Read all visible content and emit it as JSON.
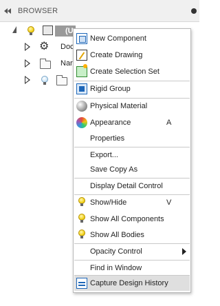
{
  "panel": {
    "title": "BROWSER"
  },
  "tree": {
    "root_label": "(U",
    "children": [
      {
        "label": "Doc"
      },
      {
        "label": "Nar"
      }
    ]
  },
  "context_menu": {
    "items": [
      {
        "id": "new-component",
        "label": "New Component",
        "icon": "new-component-icon"
      },
      {
        "id": "create-drawing",
        "label": "Create Drawing",
        "icon": "create-drawing-icon"
      },
      {
        "id": "create-selection-set",
        "label": "Create Selection Set",
        "icon": "selection-set-icon"
      },
      {
        "id": "rigid-group",
        "label": "Rigid Group",
        "icon": "rigid-group-icon"
      },
      {
        "id": "physical-material",
        "label": "Physical Material",
        "icon": "physical-material-icon"
      },
      {
        "id": "appearance",
        "label": "Appearance",
        "shortcut": "A",
        "icon": "appearance-icon"
      },
      {
        "id": "properties",
        "label": "Properties"
      },
      {
        "id": "export",
        "label": "Export..."
      },
      {
        "id": "save-copy-as",
        "label": "Save Copy As"
      },
      {
        "id": "display-detail-control",
        "label": "Display Detail Control"
      },
      {
        "id": "show-hide",
        "label": "Show/Hide",
        "shortcut": "V",
        "icon": "lightbulb-icon"
      },
      {
        "id": "show-all-components",
        "label": "Show All Components",
        "icon": "lightbulb-icon"
      },
      {
        "id": "show-all-bodies",
        "label": "Show All Bodies",
        "icon": "lightbulb-icon"
      },
      {
        "id": "opacity-control",
        "label": "Opacity Control",
        "submenu": true
      },
      {
        "id": "find-in-window",
        "label": "Find in Window"
      },
      {
        "id": "capture-design-history",
        "label": "Capture Design History",
        "icon": "capture-history-icon",
        "highlighted": true
      }
    ]
  }
}
